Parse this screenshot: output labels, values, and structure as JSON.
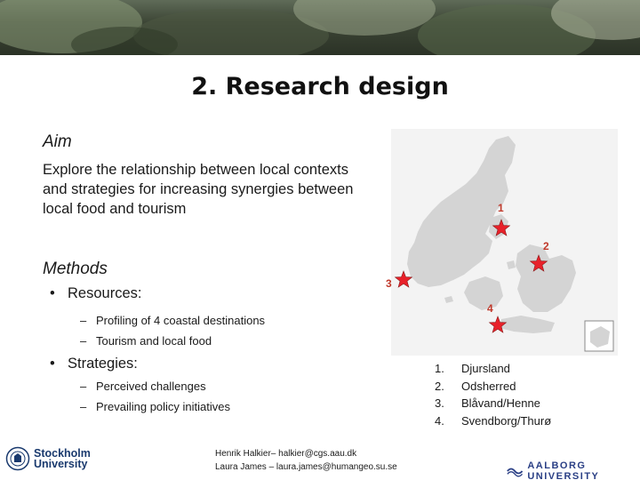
{
  "slide": {
    "title": "2. Research design",
    "aim": {
      "heading": "Aim",
      "text": "Explore the relationship between local contexts and strategies for increasing synergies between local food and tourism"
    },
    "methods": {
      "heading": "Methods",
      "bullets": [
        {
          "label": "Resources:",
          "items": [
            "Profiling of 4 coastal destinations",
            "Tourism and local food"
          ]
        },
        {
          "label": "Strategies:",
          "items": [
            "Perceived challenges",
            "Prevailing policy initiatives"
          ]
        }
      ]
    },
    "map": {
      "markers": [
        "1",
        "2",
        "3",
        "4"
      ],
      "legend": [
        {
          "num": "1.",
          "name": "Djursland"
        },
        {
          "num": "2.",
          "name": "Odsherred"
        },
        {
          "num": "3.",
          "name": "Blåvand/Henne"
        },
        {
          "num": "4.",
          "name": "Svendborg/Thurø"
        }
      ]
    },
    "footer": {
      "line1": "Henrik Halkier– halkier@cgs.aau.dk",
      "line2": "Laura James – laura.james@humangeo.su.se"
    },
    "logos": {
      "left_line1": "Stockholm",
      "left_line2": "University",
      "right": "AALBORG UNIVERSITY"
    }
  },
  "colors": {
    "marker": "#e8212a",
    "map_land": "#d4d4d4",
    "banner_dark": "#2b3226",
    "aau_blue": "#2a3f85",
    "su_blue": "#1a3a6e"
  }
}
